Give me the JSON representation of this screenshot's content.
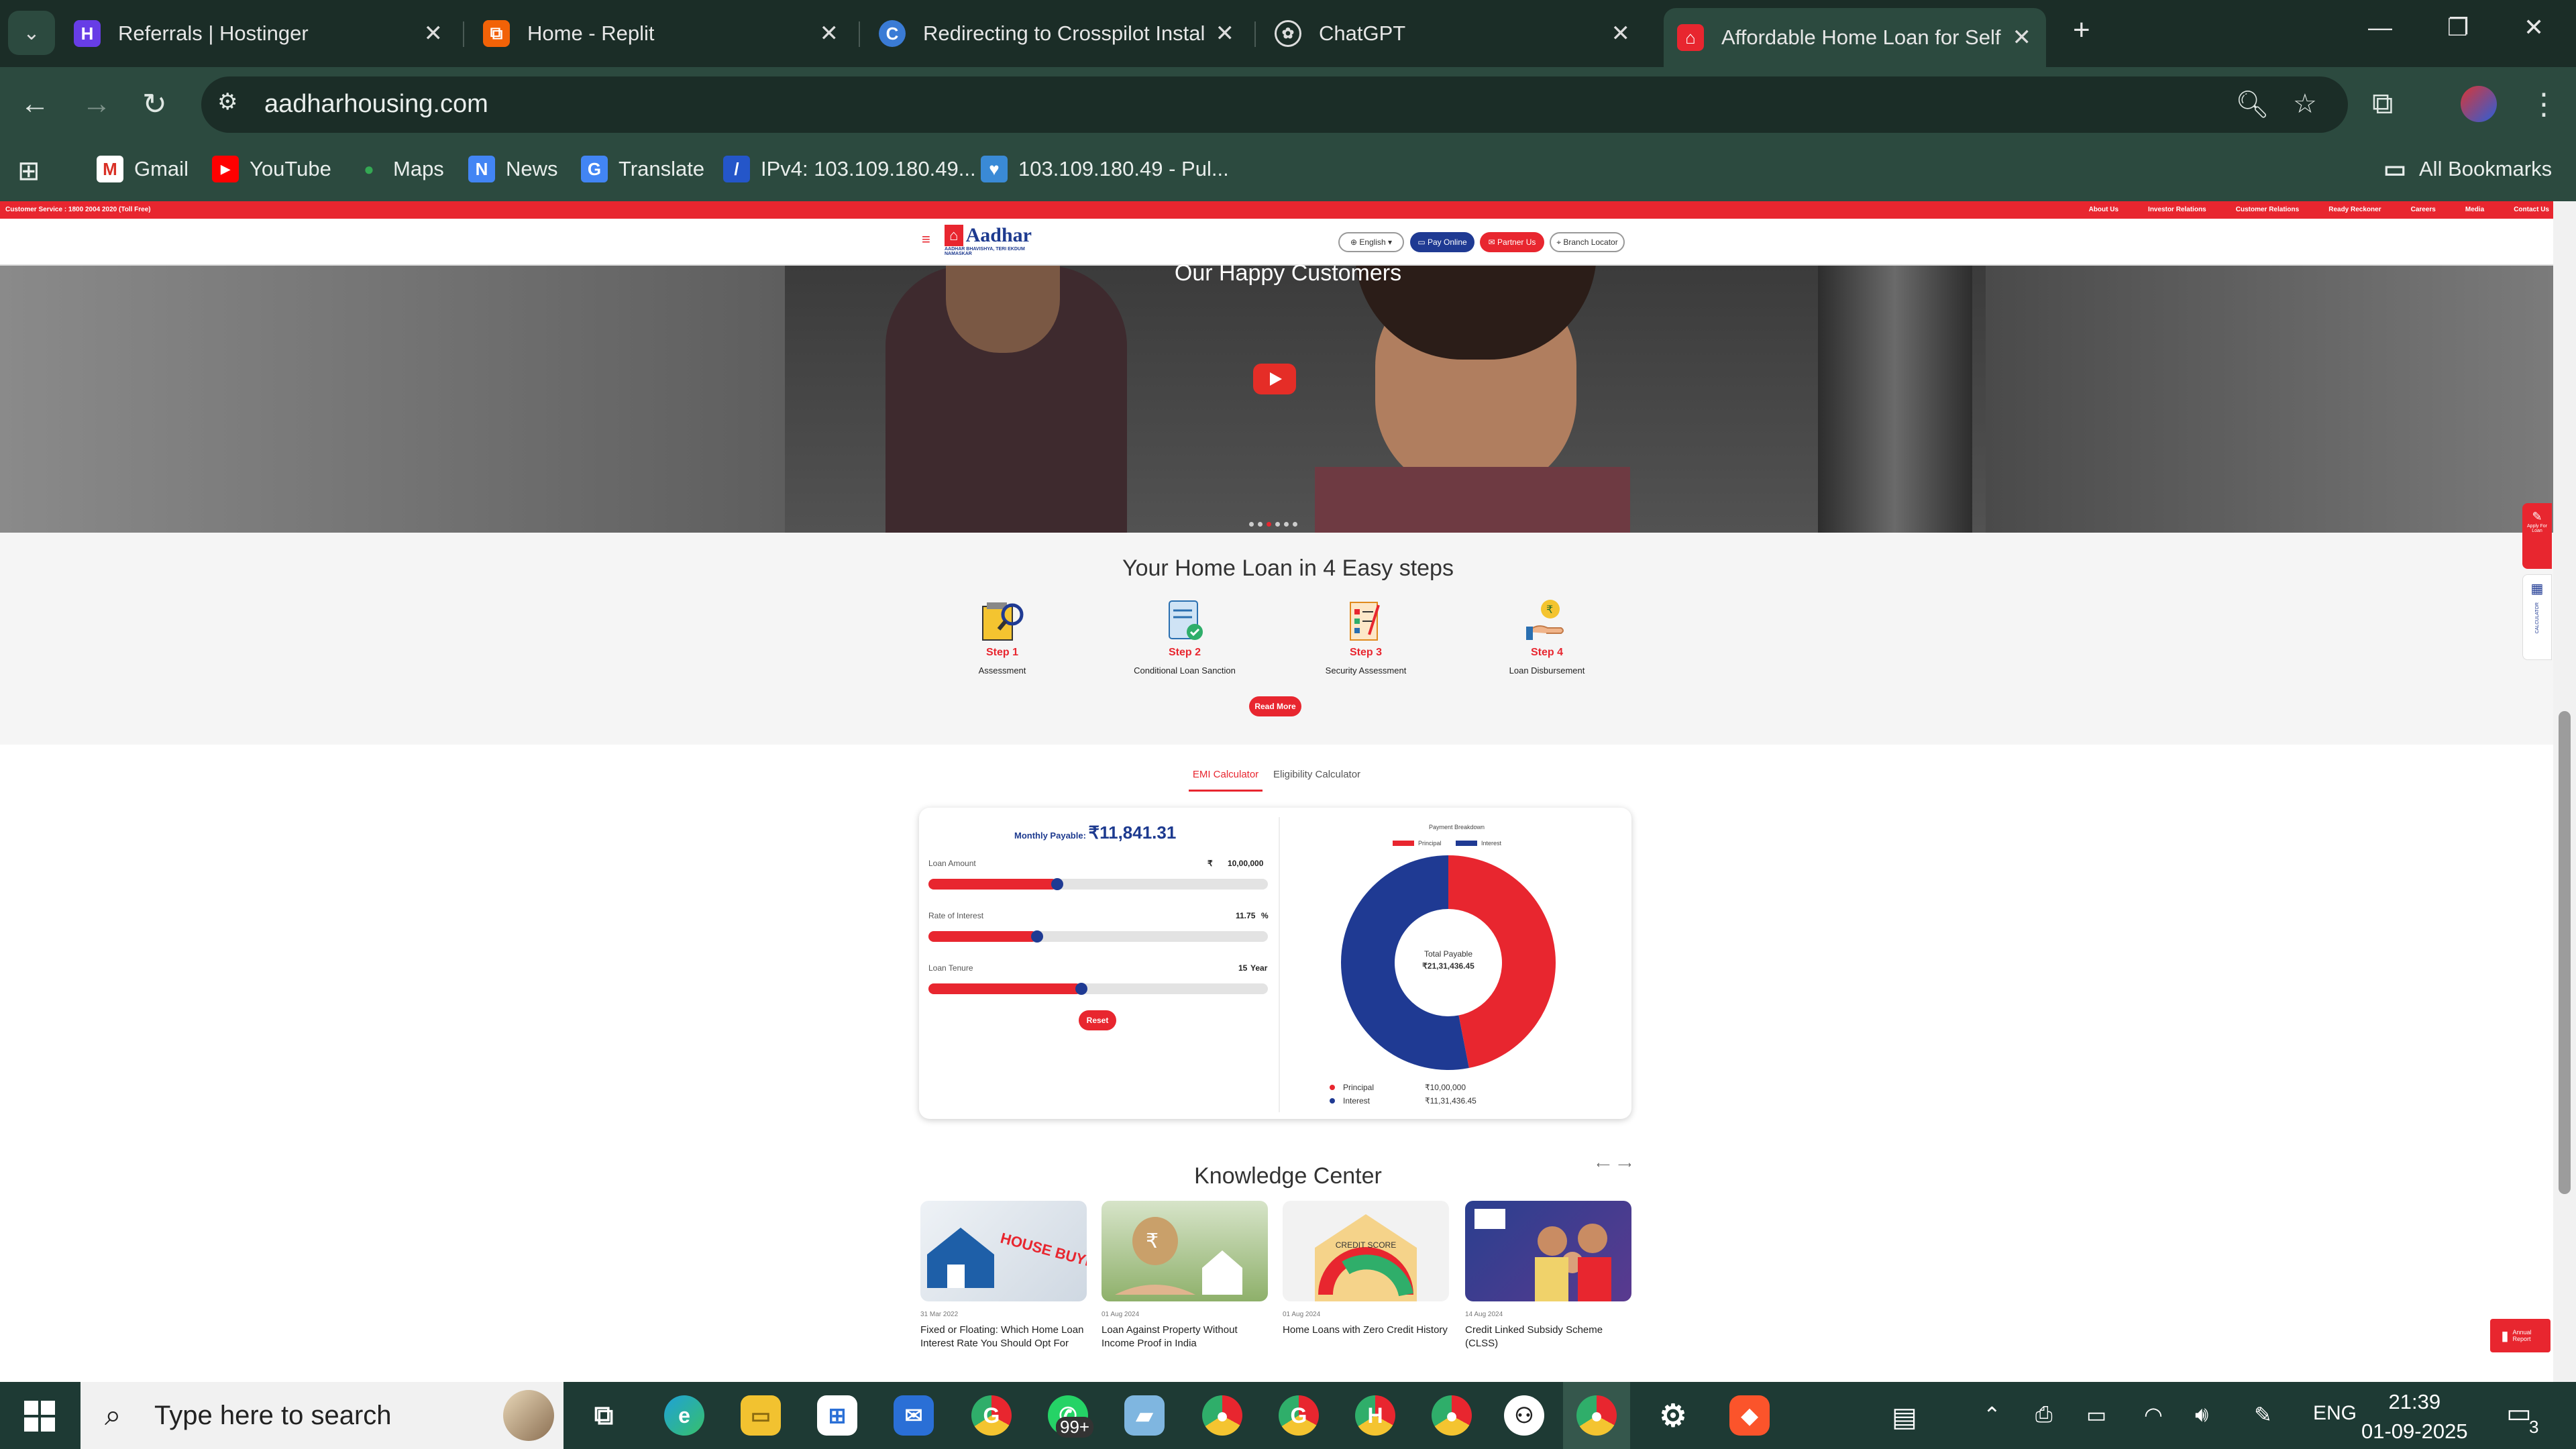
{
  "browser": {
    "tabs": [
      {
        "title": "Referrals | Hostinger",
        "icon": "hostinger-icon",
        "color": "#673de6"
      },
      {
        "title": "Home - Replit",
        "icon": "replit-icon",
        "color": "#f26207"
      },
      {
        "title": "Redirecting to Crosspilot Install",
        "icon": "crosspilot-icon",
        "color": "#3a7bd5"
      },
      {
        "title": "ChatGPT",
        "icon": "chatgpt-icon",
        "color": "#ffffff"
      },
      {
        "title": "Affordable Home Loan for Self E",
        "icon": "aadhar-icon",
        "color": "#e8262f"
      }
    ],
    "url": "aadharhousing.com",
    "bookmarks": [
      "Gmail",
      "YouTube",
      "Maps",
      "News",
      "Translate",
      "IPv4: 103.109.180.49...",
      "103.109.180.49 - Pul..."
    ],
    "all_bookmarks": "All Bookmarks"
  },
  "site": {
    "customer_service": "Customer Service : 1800 2004 2020 (Toll Free)",
    "top_links": [
      "About Us",
      "Investor Relations",
      "Customer Relations",
      "Ready Reckoner",
      "Careers",
      "Media",
      "Contact Us"
    ],
    "logo_text": "Aadhar",
    "logo_tagline": "AADHAR BHAVISHYA, TERI EKDUM NAMASKAR",
    "header_buttons": {
      "language": "English",
      "pay": "Pay Online",
      "partner": "Partner Us",
      "branch": "Branch Locator"
    },
    "video_title": "Our Happy Customers",
    "steps_title": "Your Home Loan in 4 Easy steps",
    "steps": [
      {
        "num": "Step 1",
        "desc": "Assessment"
      },
      {
        "num": "Step 2",
        "desc": "Conditional Loan Sanction"
      },
      {
        "num": "Step 3",
        "desc": "Security Assessment"
      },
      {
        "num": "Step 4",
        "desc": "Loan Disbursement"
      }
    ],
    "read_more": "Read More",
    "calc_tabs": [
      "EMI Calculator",
      "Eligibility Calculator"
    ],
    "monthly_label": "Monthly Payable:",
    "monthly_value": "₹11,841.31",
    "loan_amount": {
      "label": "Loan Amount",
      "currency": "₹",
      "value": "10,00,000",
      "fraction": 0.38
    },
    "interest_rate": {
      "label": "Rate of Interest",
      "value": "11.75",
      "unit": "%",
      "fraction": 0.32
    },
    "tenure": {
      "label": "Loan Tenure",
      "value": "15",
      "unit": "Year",
      "fraction": 0.45
    },
    "reset": "Reset",
    "payment_breakdown": "Payment Breakdown",
    "legend": {
      "principal": "Principal",
      "interest": "Interest"
    },
    "donut": {
      "total_label": "Total Payable",
      "total_value": "₹21,31,436.45",
      "principal": 1000000,
      "interest": 1131436.45,
      "principal_color": "#e8262f",
      "interest_color": "#1f3a93"
    },
    "principal_value": "₹10,00,000",
    "interest_value": "₹11,31,436.45",
    "kc_title": "Knowledge Center",
    "kc_nav": {
      "prev": "⟵",
      "next": "⟶"
    },
    "articles": [
      {
        "date": "31 Mar 2022",
        "title": "Fixed or Floating: Which Home Loan Interest Rate You Should Opt For",
        "image_text": "HOUSE BUYING TIPS"
      },
      {
        "date": "01 Aug 2024",
        "title": "Loan Against Property Without Income Proof in India",
        "image_text": "₹"
      },
      {
        "date": "01 Aug 2024",
        "title": "Home Loans with Zero Credit History",
        "image_text": "CREDIT SCORE"
      },
      {
        "date": "14 Aug 2024",
        "title": "Credit Linked Subsidy Scheme (CLSS)",
        "image_text": ""
      }
    ],
    "side_apply": "Apply For Loan",
    "side_calc": "CALCULATOR",
    "annual_report": "Annual Report"
  },
  "taskbar": {
    "search_placeholder": "Type here to search",
    "badge": "99+",
    "language": "ENG",
    "time": "21:39",
    "date": "01-09-2025",
    "notifications": "3"
  }
}
